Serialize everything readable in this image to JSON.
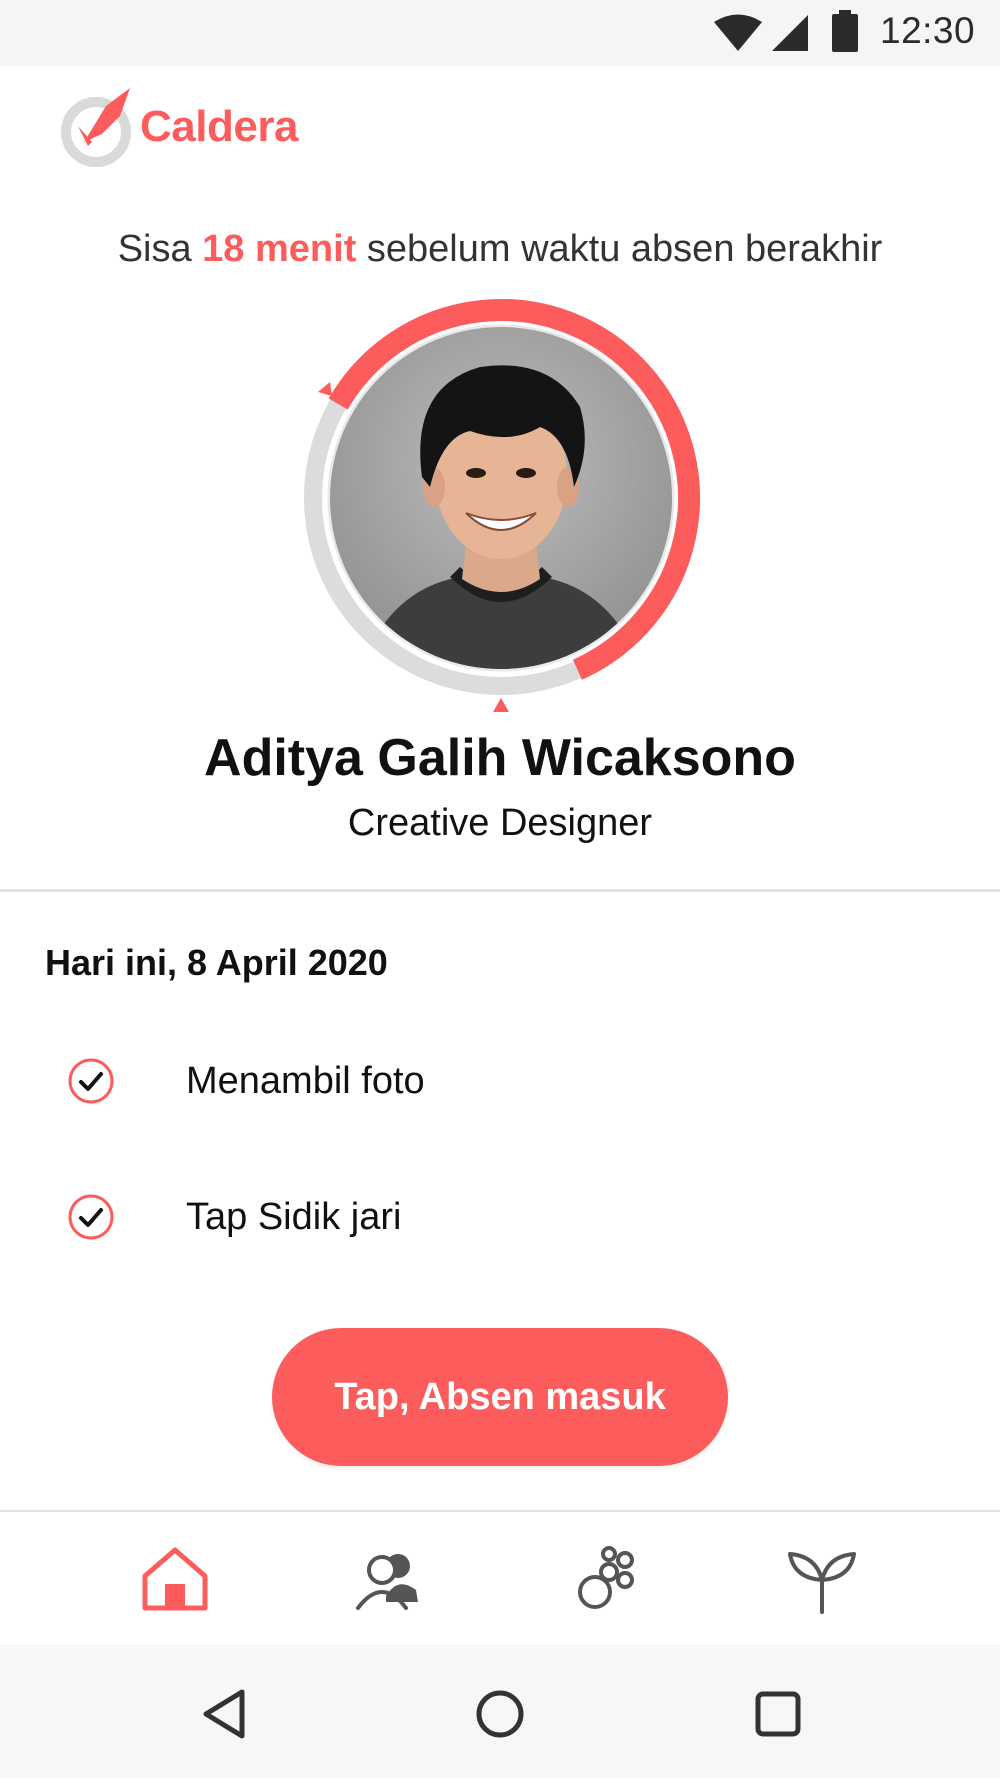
{
  "status_bar": {
    "time": "12:30",
    "icons": [
      "wifi-icon",
      "signal-icon",
      "battery-icon"
    ]
  },
  "brand": {
    "name": "Caldera",
    "accent_color": "#fc5c5c"
  },
  "countdown": {
    "prefix": "Sisa ",
    "highlight": "18 menit",
    "suffix": " sebelum waktu absen berakhir"
  },
  "profile": {
    "name": "Aditya Galih Wicaksono",
    "role": "Creative Designer",
    "time_progress": 0.6
  },
  "today": {
    "heading": "Hari ini, 8 April 2020",
    "tasks": [
      {
        "label": "Menambil foto",
        "done": true
      },
      {
        "label": "Tap Sidik jari",
        "done": true
      }
    ]
  },
  "cta": {
    "label": "Tap, Absen masuk"
  },
  "bottom_nav": {
    "items": [
      {
        "icon": "home-icon",
        "active": true
      },
      {
        "icon": "team-icon",
        "active": false
      },
      {
        "icon": "apps-icon",
        "active": false
      },
      {
        "icon": "plant-icon",
        "active": false
      }
    ]
  },
  "system_nav": {
    "items": [
      "back-icon",
      "home-circle-icon",
      "recents-icon"
    ]
  }
}
